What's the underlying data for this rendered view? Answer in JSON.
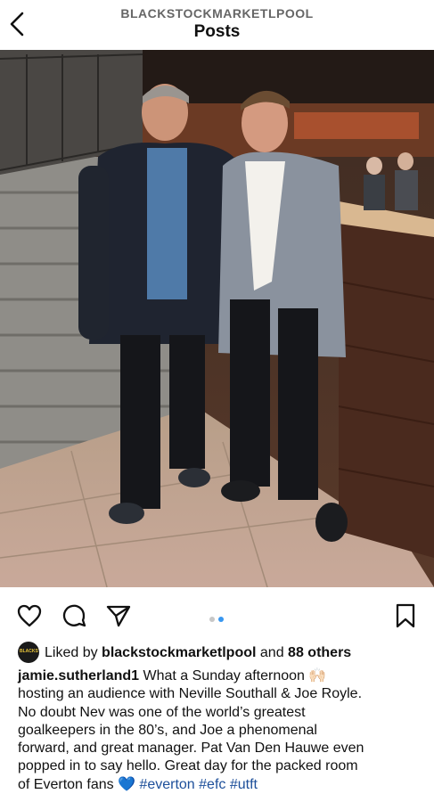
{
  "header": {
    "account": "BLACKSTOCKMARKETLPOOL",
    "title": "Posts",
    "back_icon": "chevron-left-icon"
  },
  "post": {
    "image_alt": "Two men posing together in a market hall",
    "carousel": {
      "total": 2,
      "active": 2
    },
    "actions": [
      "heart-icon",
      "comment-icon",
      "share-icon",
      "bookmark-icon"
    ]
  },
  "likes": {
    "prefix": "Liked by ",
    "user": "blackstockmarketlpool",
    "connector": " and ",
    "others": "88 others"
  },
  "caption": {
    "username": "jamie.sutherland1",
    "lines": [
      " What a Sunday afternoon 🙌🏻",
      "hosting an audience with Neville Southall & Joe Royle.",
      "No doubt Nev was one of the world’s greatest",
      "goalkeepers in the 80’s, and Joe a phenomenal",
      "forward, and great manager. Pat Van Den Hauwe even",
      "popped in to say hello. Great day for the packed room",
      "of Everton fans "
    ],
    "emoji": "💙",
    "hashtags": " #everton #efc #utft"
  },
  "colors": {
    "hashtag": "#1d4f9a",
    "dot_active": "#3897f0",
    "dot_inactive": "#c7c7c7"
  }
}
